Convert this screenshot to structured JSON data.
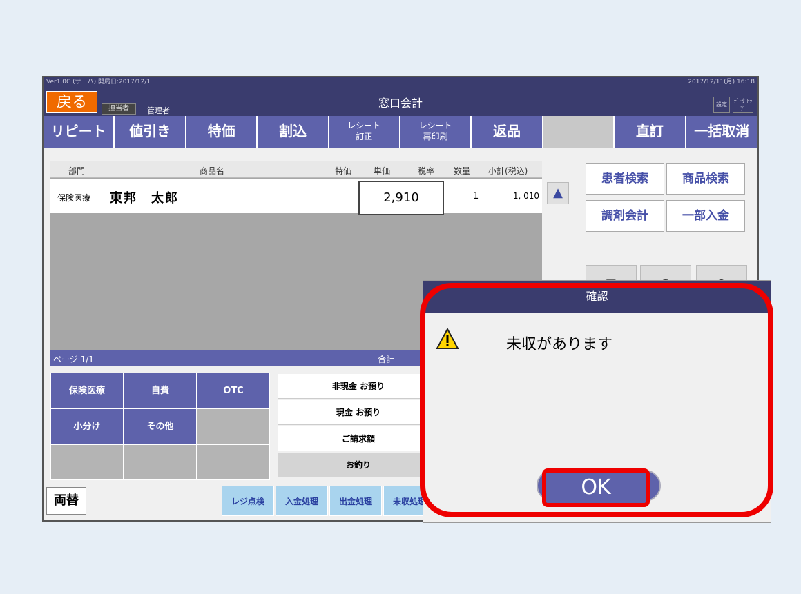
{
  "topbar": {
    "left": "Ver1.0C (サーバ) 開局日:2017/12/1",
    "right": "2017/12/11(月) 16:18"
  },
  "header": {
    "back_label": "戻る",
    "staff_label": "担当者",
    "staff_name": "管理者",
    "title": "窓口会計",
    "settings_label": "設定",
    "extra_label": "ﾃﾞｰﾀ ﾄﾗﾌﾞ"
  },
  "funcbar": [
    {
      "label": "リピート"
    },
    {
      "label": "値引き"
    },
    {
      "label": "特価"
    },
    {
      "label": "割込"
    },
    {
      "label": "レシート\n訂正"
    },
    {
      "label": "レシート\n再印刷"
    },
    {
      "label": "返品"
    },
    {
      "label": ""
    },
    {
      "label": "直訂"
    },
    {
      "label": "一括取消"
    }
  ],
  "table": {
    "headers": [
      "部門",
      "商品名",
      "特価",
      "単価",
      "税率",
      "数量",
      "小計(税込)"
    ],
    "rows": [
      {
        "dept": "保険医療",
        "name": "東邦　太郎",
        "price": "2,910",
        "qty": "1",
        "subtotal": "1, 010"
      }
    ],
    "page": "ページ 1/1",
    "total_label": "合計"
  },
  "right_buttons": {
    "patient_search": "患者検索",
    "product_search": "商品検索",
    "dispensing": "調剤会計",
    "partial_payment": "一部入金"
  },
  "keypad": [
    "7",
    "8",
    "9"
  ],
  "categories": [
    "保険医療",
    "自費",
    "OTC",
    "小分け",
    "その他"
  ],
  "payment": {
    "noncash": "非現金 お預り",
    "cash": "現金 お預り",
    "invoice": "ご請求額",
    "change": "お釣り"
  },
  "bottom": {
    "exchange": "両替",
    "register_check": "レジ点検",
    "deposit": "入金処理",
    "withdraw": "出金処理",
    "uncollected": "未収処理"
  },
  "dialog": {
    "title": "確認",
    "message": "未収があります",
    "ok": "OK",
    "accent": "#e00000"
  }
}
